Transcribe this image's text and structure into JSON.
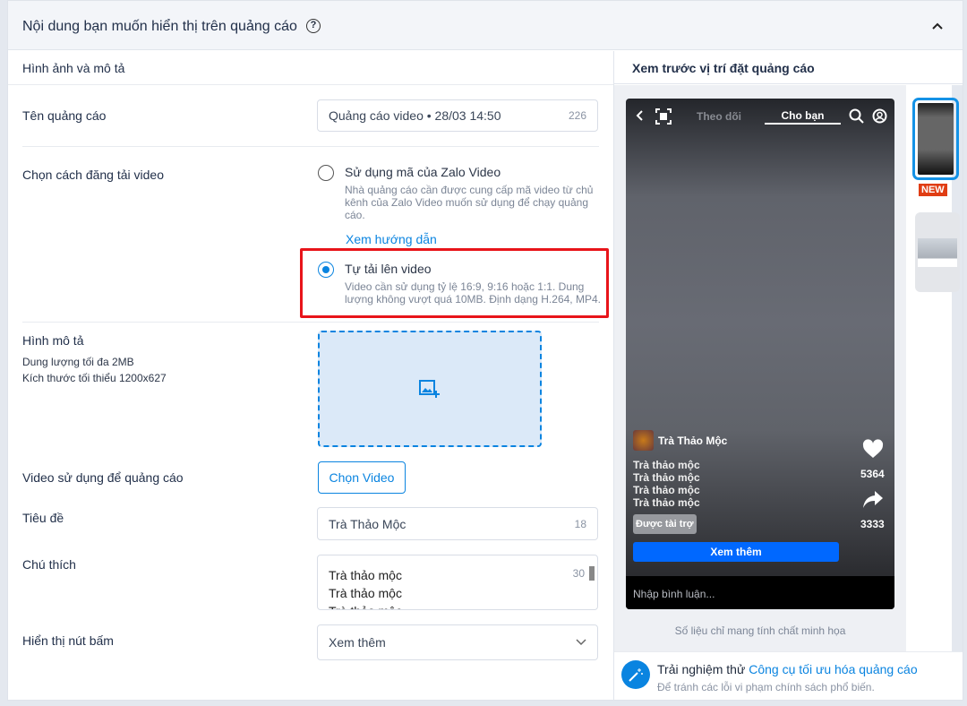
{
  "header": {
    "title": "Nội dung bạn muốn hiển thị trên quảng cáo",
    "help_icon": "?"
  },
  "left": {
    "section_title": "Hình ảnh và mô tả",
    "ad_name": {
      "label": "Tên quảng cáo",
      "value": "Quảng cáo video • 28/03 14:50",
      "count": "226"
    },
    "upload_method": {
      "label": "Chọn cách đăng tải video",
      "options": [
        {
          "title": "Sử dụng mã của Zalo Video",
          "desc": "Nhà quảng cáo cần được cung cấp mã video từ chủ kênh của Zalo Video muốn sử dụng để chạy quảng cáo.",
          "selected": false
        },
        {
          "title": "Tự tải lên video",
          "desc": "Video cần sử dụng tỷ lệ 16:9, 9:16 hoặc 1:1. Dung lượng không vượt quá 10MB. Định dạng H.264, MP4.",
          "selected": true
        }
      ],
      "guide_link": "Xem hướng dẫn"
    },
    "image": {
      "label": "Hình mô tả",
      "hint1": "Dung lượng tối đa 2MB",
      "hint2": "Kích thước tối thiểu 1200x627"
    },
    "video": {
      "label": "Video sử dụng để quảng cáo",
      "button": "Chọn Video"
    },
    "title": {
      "label": "Tiêu đề",
      "value": "Trà Thảo Mộc",
      "count": "18"
    },
    "caption": {
      "label": "Chú thích",
      "lines": [
        "Trà thảo mộc",
        "Trà thảo mộc",
        "Trà thảo mộc"
      ],
      "count": "30"
    },
    "cta": {
      "label": "Hiển thị nút bấm",
      "value": "Xem thêm"
    }
  },
  "right": {
    "title": "Xem trước vị trí đặt quảng cáo",
    "phone": {
      "tab_follow": "Theo dõi",
      "tab_for_you": "Cho bạn",
      "brand": "Trà Thảo Mộc",
      "lines": [
        "Trà thảo mộc",
        "Trà thảo mộc",
        "Trà thảo mộc",
        "Trà thảo mộc"
      ],
      "sponsored": "Được tài trợ",
      "cta": "Xem thêm",
      "likes": "5364",
      "shares": "3333",
      "comment_placeholder": "Nhập bình luận..."
    },
    "new_badge": "NEW",
    "note": "Số liệu chỉ mang tính chất minh họa",
    "tip": {
      "prefix": "Trải nghiệm thử ",
      "link": "Công cụ tối ưu hóa quảng cáo",
      "desc": "Để tránh các lỗi vi phạm chính sách phổ biến."
    }
  },
  "colors": {
    "accent": "#0a84e0",
    "highlight": "#e8141a",
    "cta": "#0068ff",
    "new": "#e03d14"
  }
}
